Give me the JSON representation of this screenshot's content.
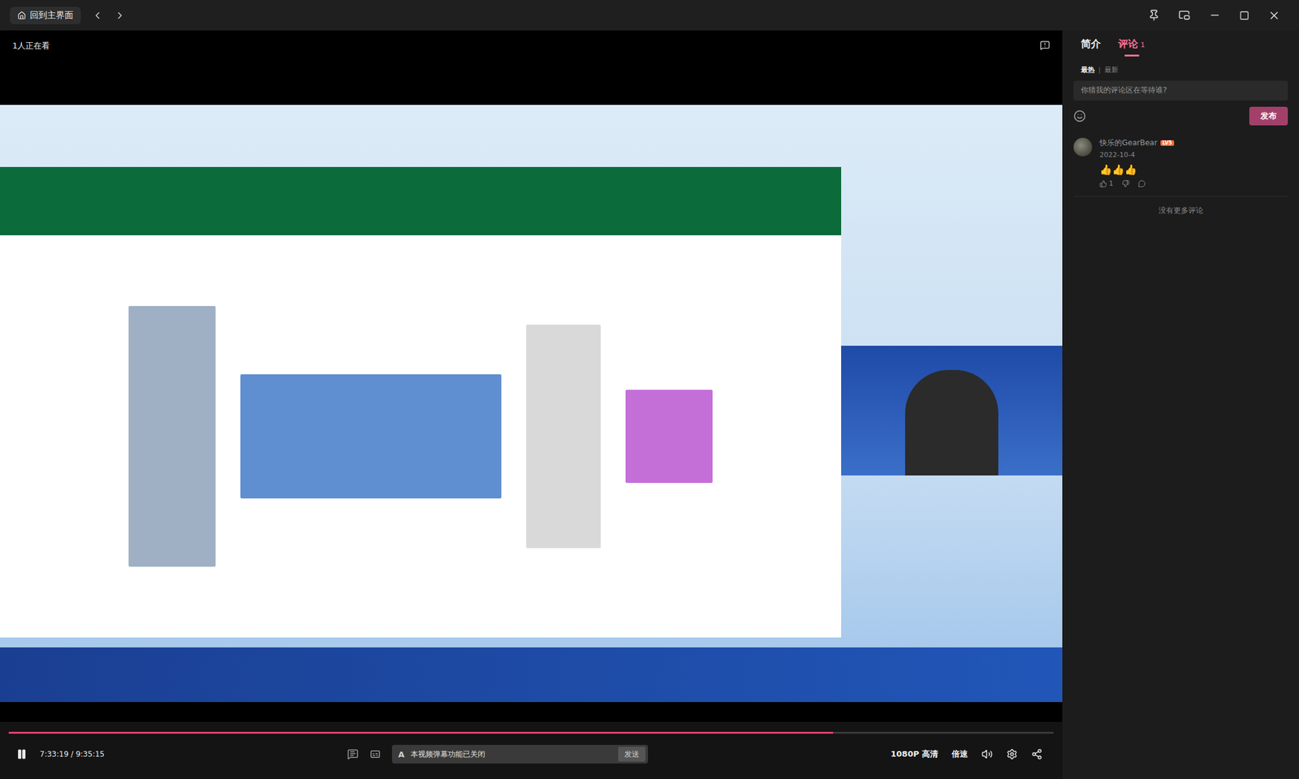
{
  "topbar": {
    "home_button": "回到主界面"
  },
  "video": {
    "viewers": "1人正在看"
  },
  "panel": {
    "tabs": [
      {
        "label": "简介",
        "count": "",
        "selected": false
      },
      {
        "label": "评论",
        "count": "1",
        "selected": true
      }
    ],
    "sort": [
      {
        "label": "最热",
        "selected": true
      },
      {
        "label": "最新",
        "selected": false
      }
    ],
    "sort_separator": "|",
    "comment_box": {
      "placeholder": "你猜我的评论区在等待谁?",
      "button": "发布"
    },
    "comments": [
      {
        "user": "快乐的GearBear",
        "level": "LV5",
        "date": "2022-10-4",
        "text": "👍👍👍",
        "likes": "1"
      }
    ],
    "end_note": "没有更多评论"
  },
  "player": {
    "playing": true,
    "time": "7:33:19 / 9:35:15",
    "progress": 0.789,
    "danmaku_placeholder": "本视频弹幕功能已关闭",
    "send": "发送",
    "quality": "1080P 高清",
    "speed": "倍速"
  }
}
